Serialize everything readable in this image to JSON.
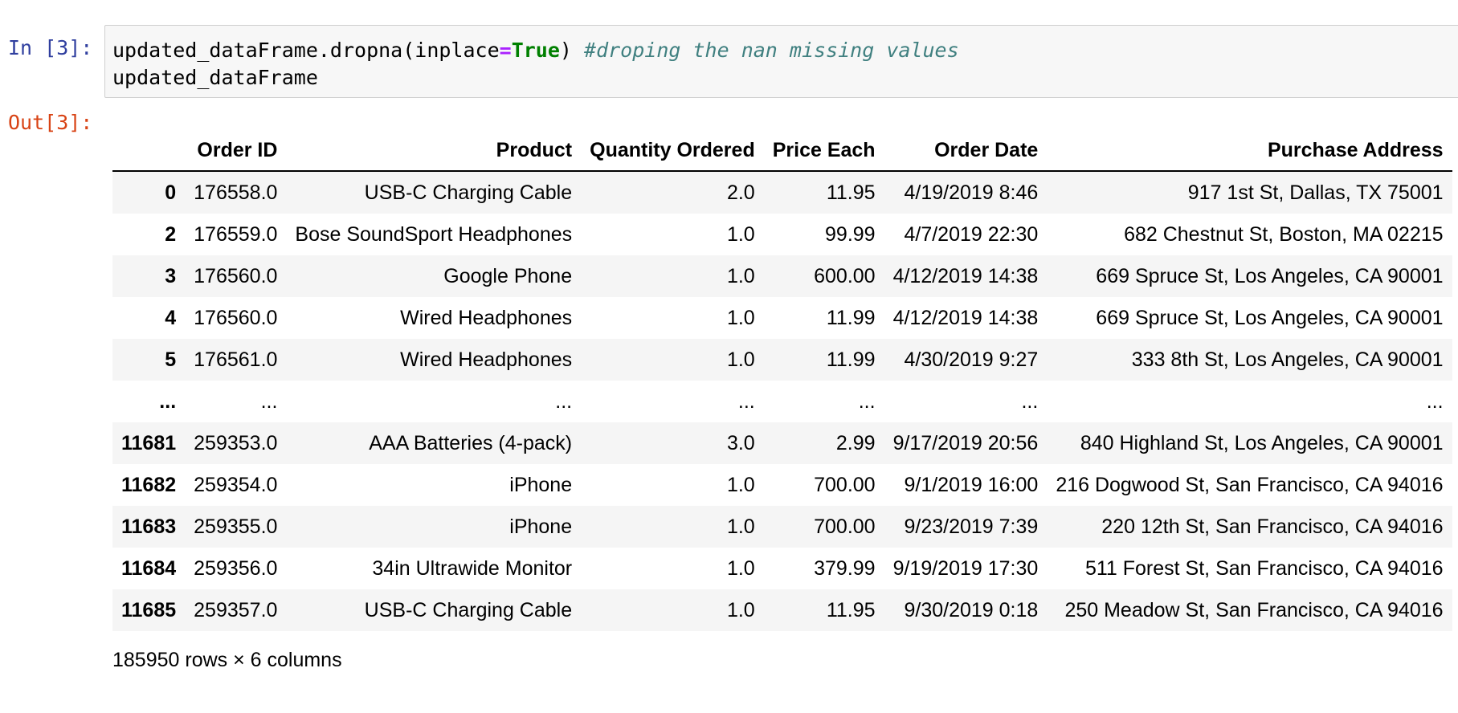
{
  "cell": {
    "in_prompt": "In [3]:",
    "out_prompt": "Out[3]:",
    "code": {
      "line1": {
        "call": "updated_dataFrame.dropna(inplace",
        "op": "=",
        "kw": "True",
        "close": ") ",
        "comment": "#droping the nan missing values"
      },
      "line2": "updated_dataFrame"
    }
  },
  "table": {
    "columns": [
      "",
      "Order ID",
      "Product",
      "Quantity Ordered",
      "Price Each",
      "Order Date",
      "Purchase Address"
    ],
    "rows": [
      [
        "0",
        "176558.0",
        "USB-C Charging Cable",
        "2.0",
        "11.95",
        "4/19/2019 8:46",
        "917 1st St, Dallas, TX 75001"
      ],
      [
        "2",
        "176559.0",
        "Bose SoundSport Headphones",
        "1.0",
        "99.99",
        "4/7/2019 22:30",
        "682 Chestnut St, Boston, MA 02215"
      ],
      [
        "3",
        "176560.0",
        "Google Phone",
        "1.0",
        "600.00",
        "4/12/2019 14:38",
        "669 Spruce St, Los Angeles, CA 90001"
      ],
      [
        "4",
        "176560.0",
        "Wired Headphones",
        "1.0",
        "11.99",
        "4/12/2019 14:38",
        "669 Spruce St, Los Angeles, CA 90001"
      ],
      [
        "5",
        "176561.0",
        "Wired Headphones",
        "1.0",
        "11.99",
        "4/30/2019 9:27",
        "333 8th St, Los Angeles, CA 90001"
      ],
      [
        "...",
        "...",
        "...",
        "...",
        "...",
        "...",
        "..."
      ],
      [
        "11681",
        "259353.0",
        "AAA Batteries (4-pack)",
        "3.0",
        "2.99",
        "9/17/2019 20:56",
        "840 Highland St, Los Angeles, CA 90001"
      ],
      [
        "11682",
        "259354.0",
        "iPhone",
        "1.0",
        "700.00",
        "9/1/2019 16:00",
        "216 Dogwood St, San Francisco, CA 94016"
      ],
      [
        "11683",
        "259355.0",
        "iPhone",
        "1.0",
        "700.00",
        "9/23/2019 7:39",
        "220 12th St, San Francisco, CA 94016"
      ],
      [
        "11684",
        "259356.0",
        "34in Ultrawide Monitor",
        "1.0",
        "379.99",
        "9/19/2019 17:30",
        "511 Forest St, San Francisco, CA 94016"
      ],
      [
        "11685",
        "259357.0",
        "USB-C Charging Cable",
        "1.0",
        "11.95",
        "9/30/2019 0:18",
        "250 Meadow St, San Francisco, CA 94016"
      ]
    ],
    "shape_note": "185950 rows × 6 columns"
  }
}
